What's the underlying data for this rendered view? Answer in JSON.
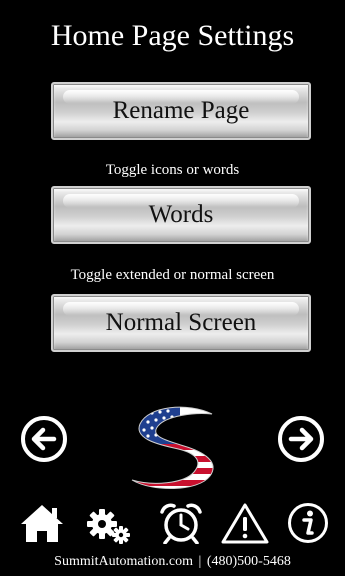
{
  "header": {
    "title": "Home Page Settings"
  },
  "buttons": {
    "rename": "Rename Page",
    "words": "Words",
    "screen": "Normal Screen"
  },
  "captions": {
    "icons_words": "Toggle icons or words",
    "screen": "Toggle extended or normal screen"
  },
  "navigation": {
    "back_icon": "arrow-left-circle-icon",
    "forward_icon": "arrow-right-circle-icon"
  },
  "toolbar": {
    "icons": [
      "home-icon",
      "settings-gears-icon",
      "alarm-clock-icon",
      "warning-icon",
      "info-icon"
    ]
  },
  "footer": {
    "website": "SummitAutomation.com",
    "separator": "|",
    "phone": "(480)500-5468"
  },
  "colors": {
    "background": "#000000",
    "text": "#ffffff",
    "button_text": "#111111",
    "logo_red": "#c8102e",
    "logo_blue": "#1f3f8f"
  }
}
